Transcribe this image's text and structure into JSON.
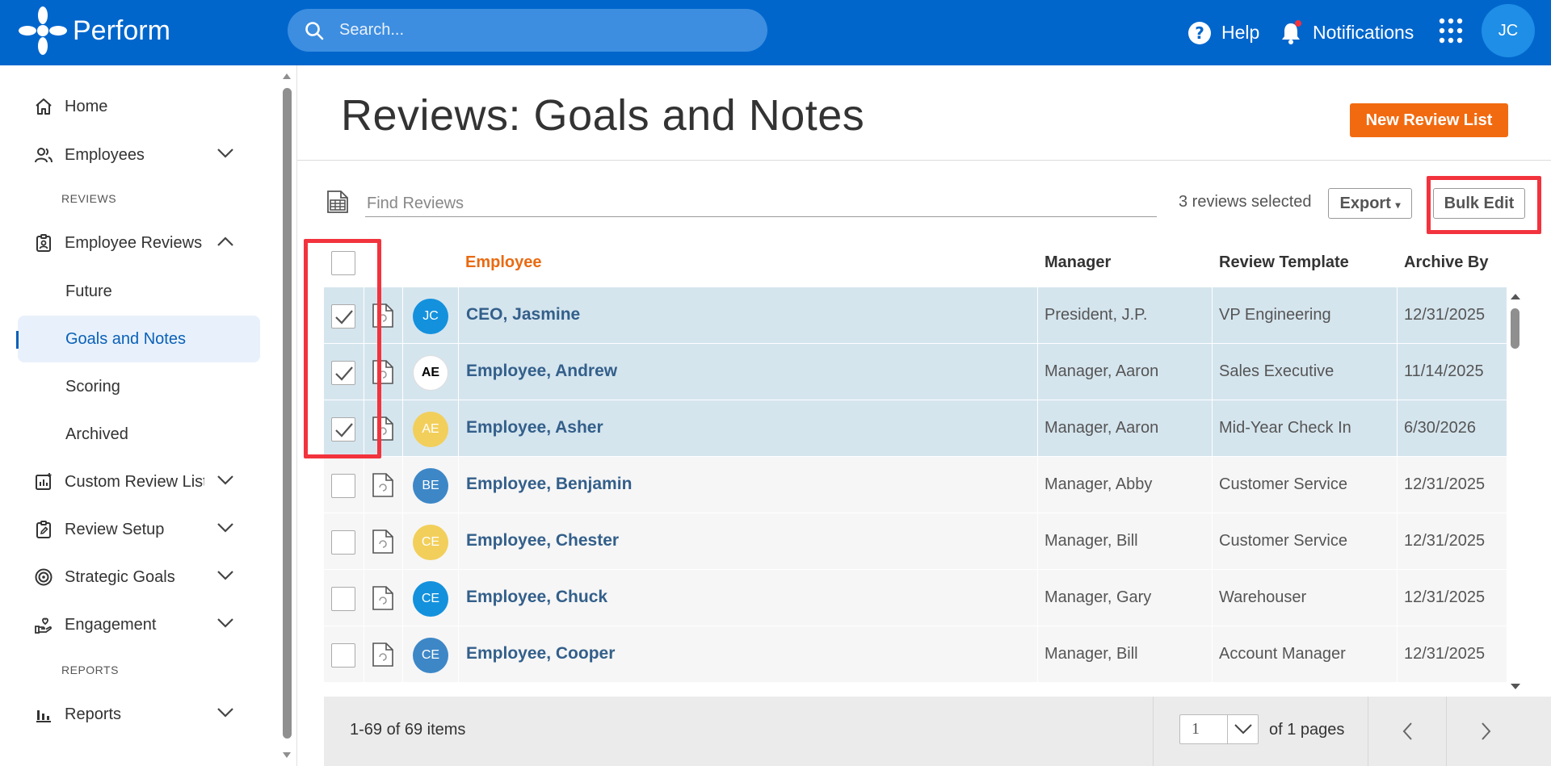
{
  "header": {
    "brand": "Perform",
    "search_placeholder": "Search...",
    "help_label": "Help",
    "notifications_label": "Notifications",
    "user_initials": "JC"
  },
  "sidebar": {
    "home": "Home",
    "employees": "Employees",
    "section_reviews": "REVIEWS",
    "employee_reviews": "Employee Reviews",
    "sub_items": [
      "Future",
      "Goals and Notes",
      "Scoring",
      "Archived"
    ],
    "custom_review_lists": "Custom Review Lists",
    "review_setup": "Review Setup",
    "strategic_goals": "Strategic Goals",
    "engagement": "Engagement",
    "section_reports": "REPORTS",
    "reports": "Reports"
  },
  "page": {
    "title": "Reviews: Goals and Notes",
    "new_button": "New Review List",
    "find_placeholder": "Find Reviews",
    "selected_count": "3 reviews selected",
    "export_label": "Export",
    "bulk_edit_label": "Bulk Edit"
  },
  "table": {
    "columns": {
      "employee": "Employee",
      "manager": "Manager",
      "template": "Review Template",
      "archive_by": "Archive By"
    },
    "rows": [
      {
        "initials": "JC",
        "avatar_color": "#1391dd",
        "name": "CEO, Jasmine",
        "manager": "President, J.P.",
        "template": "VP Engineering",
        "archive_by": "12/31/2025",
        "selected": true
      },
      {
        "initials": "AE",
        "avatar_color": "#ffffff",
        "name": "Employee, Andrew",
        "manager": "Manager, Aaron",
        "template": "Sales Executive",
        "archive_by": "11/14/2025",
        "selected": true
      },
      {
        "initials": "AE",
        "avatar_color": "#f2cf5b",
        "name": "Employee, Asher",
        "manager": "Manager, Aaron",
        "template": "Mid-Year Check In",
        "archive_by": "6/30/2026",
        "selected": true
      },
      {
        "initials": "BE",
        "avatar_color": "#3d87c7",
        "name": "Employee, Benjamin",
        "manager": "Manager, Abby",
        "template": "Customer Service",
        "archive_by": "12/31/2025",
        "selected": false
      },
      {
        "initials": "CE",
        "avatar_color": "#f2cf5b",
        "name": "Employee, Chester",
        "manager": "Manager, Bill",
        "template": "Customer Service",
        "archive_by": "12/31/2025",
        "selected": false
      },
      {
        "initials": "CE",
        "avatar_color": "#1391dd",
        "name": "Employee, Chuck",
        "manager": "Manager, Gary",
        "template": "Warehouser",
        "archive_by": "12/31/2025",
        "selected": false
      },
      {
        "initials": "CE",
        "avatar_color": "#3d87c7",
        "name": "Employee, Cooper",
        "manager": "Manager, Bill",
        "template": "Account Manager",
        "archive_by": "12/31/2025",
        "selected": false
      }
    ]
  },
  "footer": {
    "items_count": "1-69 of 69 items",
    "page_value": "1",
    "of_pages": "of 1 pages"
  }
}
